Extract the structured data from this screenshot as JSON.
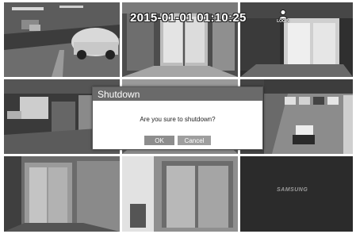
{
  "overlay": {
    "timestamp": "2015-01-01 01:10:25",
    "login_label": "LOGIN",
    "login_icon": "user-icon",
    "brand": "SAMSUNG"
  },
  "cameras": [
    {
      "index": 1,
      "scene": "parking-garage"
    },
    {
      "index": 2,
      "scene": "lobby-glass-doors"
    },
    {
      "index": 3,
      "scene": "entrance-glass-doors"
    },
    {
      "index": 4,
      "scene": "building-corridor"
    },
    {
      "index": 5,
      "scene": "hallway"
    },
    {
      "index": 6,
      "scene": "outdoor-parking-lot"
    },
    {
      "index": 7,
      "scene": "elevator"
    },
    {
      "index": 8,
      "scene": "elevator-doors"
    },
    {
      "index": 9,
      "scene": "no-signal"
    }
  ],
  "dialog": {
    "title": "Shutdown",
    "message": "Are you sure to shutdown?",
    "ok_label": "OK",
    "cancel_label": "Cancel"
  }
}
